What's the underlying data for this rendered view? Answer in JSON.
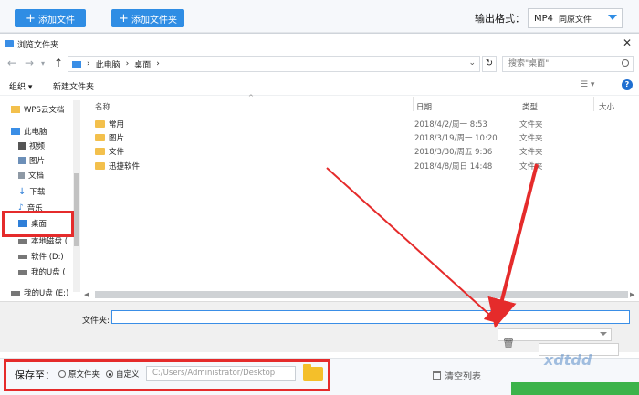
{
  "topbar": {
    "add_file": "添加文件",
    "add_folder": "添加文件夹",
    "format_label": "输出格式：",
    "format_value": "MP4",
    "format_sub": "同原文件"
  },
  "dialog": {
    "title": "浏览文件夹",
    "close": "✕",
    "breadcrumb": [
      "此电脑",
      "桌面"
    ],
    "search_placeholder": "搜索\"桌面\"",
    "toolbar": {
      "organize": "组织",
      "new_folder": "新建文件夹"
    },
    "columns": {
      "name": "名称",
      "date": "日期",
      "type": "类型",
      "size": "大小"
    },
    "nav_items": [
      {
        "label": "WPS云文档",
        "icon": "folder-icon"
      },
      {
        "label": "此电脑",
        "icon": "computer-icon"
      },
      {
        "label": "视频",
        "icon": "video-icon"
      },
      {
        "label": "图片",
        "icon": "picture-icon"
      },
      {
        "label": "文档",
        "icon": "document-icon"
      },
      {
        "label": "下载",
        "icon": "download-icon"
      },
      {
        "label": "音乐",
        "icon": "music-icon"
      },
      {
        "label": "桌面",
        "icon": "desktop-icon"
      },
      {
        "label": "本地磁盘 (",
        "icon": "drive-icon"
      },
      {
        "label": "软件 (D:)",
        "icon": "drive-icon"
      },
      {
        "label": "我的U盘 (",
        "icon": "usb-icon"
      },
      {
        "label": "我的U盘 (E:)",
        "icon": "usb-icon"
      }
    ],
    "files": [
      {
        "name": "常用",
        "date": "2018/4/2/周一 8:53",
        "type": "文件夹"
      },
      {
        "name": "图片",
        "date": "2018/3/19/周一 10:20",
        "type": "文件夹"
      },
      {
        "name": "文件",
        "date": "2018/3/30/周五 9:36",
        "type": "文件夹"
      },
      {
        "name": "迅捷软件",
        "date": "2018/4/8/周日 14:48",
        "type": "文件夹"
      }
    ],
    "folder_label": "文件夹:"
  },
  "savebar": {
    "save_to": "保存至：",
    "opt_original": "原文件夹",
    "opt_custom": "自定义",
    "path": "C:/Users/Administrator/Desktop",
    "clear_list": "清空列表"
  },
  "watermark": "xdtdd",
  "colors": {
    "accent": "#2f8de4",
    "highlight": "#e52b2b",
    "folder": "#f3c04c",
    "start": "#3cb34a"
  }
}
